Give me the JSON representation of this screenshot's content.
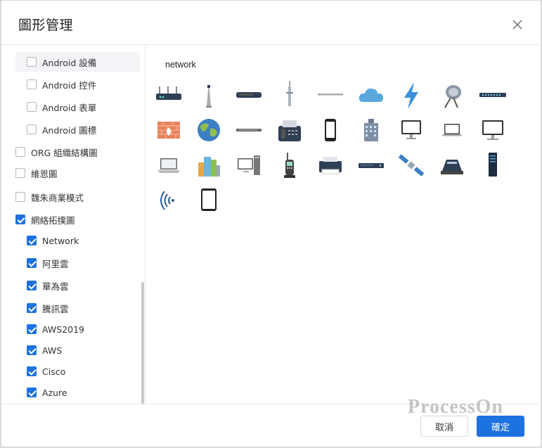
{
  "dialog": {
    "title": "圖形管理"
  },
  "sidebar": {
    "items": [
      {
        "label": "Android 設備",
        "checked": false,
        "level": 1
      },
      {
        "label": "Android 控件",
        "checked": false,
        "level": 1
      },
      {
        "label": "Android 表單",
        "checked": false,
        "level": 1
      },
      {
        "label": "Android 圖標",
        "checked": false,
        "level": 1
      },
      {
        "label": "ORG 組織結構圖",
        "checked": false,
        "level": 0
      },
      {
        "label": "維恩圖",
        "checked": false,
        "level": 0
      },
      {
        "label": "魏朱商業模式",
        "checked": false,
        "level": 0
      },
      {
        "label": "網絡拓撲圖",
        "checked": true,
        "level": 0
      },
      {
        "label": "Network",
        "checked": true,
        "level": 1
      },
      {
        "label": "阿里雲",
        "checked": true,
        "level": 1
      },
      {
        "label": "華為雲",
        "checked": true,
        "level": 1
      },
      {
        "label": "騰訊雲",
        "checked": true,
        "level": 1
      },
      {
        "label": "AWS2019",
        "checked": true,
        "level": 1
      },
      {
        "label": "AWS",
        "checked": true,
        "level": 1
      },
      {
        "label": "Cisco",
        "checked": true,
        "level": 1
      },
      {
        "label": "Azure",
        "checked": true,
        "level": 1
      }
    ]
  },
  "content": {
    "category": "network",
    "icons": [
      "router-icon",
      "antenna-tower-icon",
      "modem-icon",
      "radio-tower-icon",
      "cable-icon",
      "cloud-icon",
      "lightning-icon",
      "satellite-dish-icon",
      "switch-icon",
      "firewall-icon",
      "globe-icon",
      "hub-icon",
      "fax-icon",
      "smartphone-icon",
      "office-building-icon",
      "monitor-icon",
      "laptop-icon",
      "desktop-icon",
      "notebook-icon",
      "city-icon",
      "workstation-icon",
      "cordless-phone-icon",
      "printer-icon",
      "rack-server-icon",
      "satellite-icon",
      "scanner-icon",
      "server-tower-icon",
      "wireless-signal-icon",
      "tablet-icon"
    ]
  },
  "footer": {
    "watermark": "ProcessOn",
    "cancel_label": "取消",
    "ok_label": "確定"
  },
  "colors": {
    "accent": "#1e72e0",
    "icon_dark": "#2f3f55",
    "icon_blue": "#5aa7dc"
  }
}
